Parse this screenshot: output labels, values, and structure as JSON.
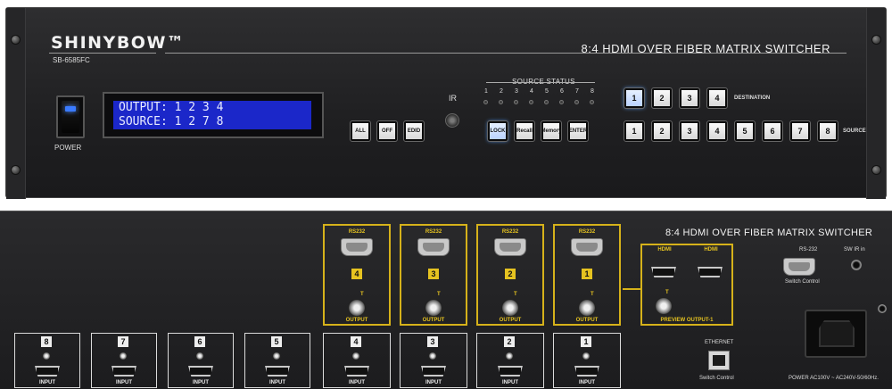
{
  "front": {
    "brand": "SHINYBOW™",
    "model": "SB-6585FC",
    "title": "8:4 HDMI OVER FIBER MATRIX SWITCHER",
    "power_label": "POWER",
    "lcd": {
      "line1": "OUTPUT: 1 2 3 4",
      "line2": "SOURCE: 1 2 7 8"
    },
    "ir_label": "IR",
    "func_buttons": {
      "all": "ALL",
      "off": "OFF",
      "edid": "EDID"
    },
    "source_status": {
      "label": "SOURCE  STATUS",
      "numbers": [
        "1",
        "2",
        "3",
        "4",
        "5",
        "6",
        "7",
        "8"
      ]
    },
    "ctrl_buttons": {
      "lock": "LOCK",
      "recall": "Recall",
      "memory": "Memory",
      "enter": "ENTER"
    },
    "destination": {
      "label": "DESTINATION",
      "buttons": [
        "1",
        "2",
        "3",
        "4"
      ]
    },
    "source": {
      "label": "SOURCE",
      "buttons": [
        "1",
        "2",
        "3",
        "4",
        "5",
        "6",
        "7",
        "8"
      ]
    }
  },
  "rear": {
    "title": "8:4 HDMI OVER FIBER MATRIX SWITCHER",
    "rs232_label": "RS232",
    "t_label": "T",
    "output_label": "OUTPUT",
    "output_numbers": [
      "4",
      "3",
      "2",
      "1"
    ],
    "input_label": "INPUT",
    "input_numbers_upper": [
      "8",
      "7",
      "6",
      "5"
    ],
    "input_numbers_lower": [
      "4",
      "3",
      "2",
      "1"
    ],
    "hdmi_label": "HDMI",
    "preview_label": "PREVIEW  OUTPUT-1",
    "rs232_control_label": "RS-232",
    "switch_control": "Switch Control",
    "sw_ir_in": "SW IR in",
    "ethernet": "ETHERNET",
    "power_spec": "POWER AC100V ~ AC240V-50/60Hz."
  },
  "colors": {
    "accent_yellow": "#e6c320",
    "lcd_blue": "#1b27c9",
    "led_blue": "#3a7bff"
  }
}
